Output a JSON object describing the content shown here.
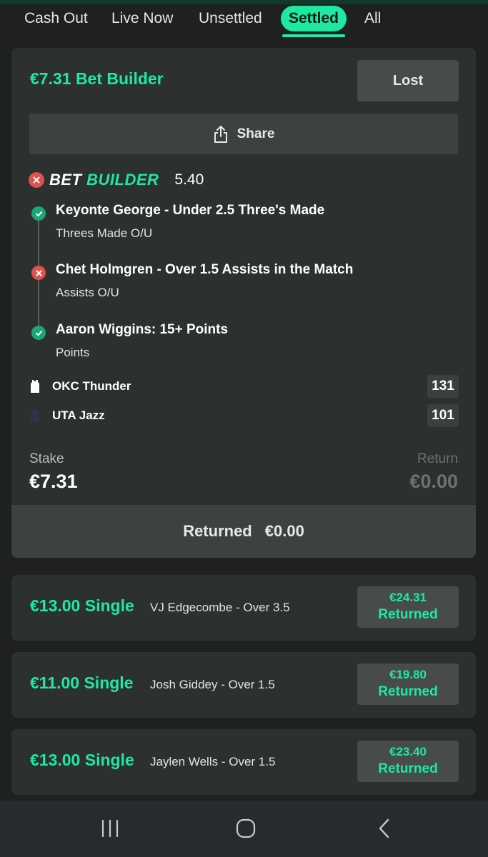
{
  "tabs": [
    {
      "label": "Cash Out",
      "active": false
    },
    {
      "label": "Live Now",
      "active": false
    },
    {
      "label": "Unsettled",
      "active": false
    },
    {
      "label": "Settled",
      "active": true
    },
    {
      "label": "All",
      "active": false
    }
  ],
  "main_bet": {
    "title": "€7.31 Bet Builder",
    "status": "Lost",
    "share_label": "Share",
    "builder_logo_bet": "BET",
    "builder_logo_builder": "BUILDER",
    "builder_result": "lost",
    "odds": "5.40",
    "legs": [
      {
        "title": "Keyonte George - Under 2.5 Three's Made",
        "market": "Threes Made O/U",
        "result": "won"
      },
      {
        "title": "Chet Holmgren - Over 1.5 Assists in the Match",
        "market": "Assists O/U",
        "result": "lost"
      },
      {
        "title": "Aaron Wiggins: 15+ Points",
        "market": "Points",
        "result": "won"
      }
    ],
    "teams": [
      {
        "name": "OKC Thunder",
        "score": "131",
        "jersey_color": "#ffffff"
      },
      {
        "name": "UTA Jazz",
        "score": "101",
        "jersey_color": "#3a2f48"
      }
    ],
    "stake_label": "Stake",
    "stake_value": "€7.31",
    "return_label": "Return",
    "return_value": "€0.00",
    "returned_label": "Returned",
    "returned_value": "€0.00"
  },
  "singles": [
    {
      "title": "€13.00 Single",
      "description": "VJ Edgecombe - Over 3.5",
      "amount": "€24.31",
      "status": "Returned"
    },
    {
      "title": "€11.00 Single",
      "description": "Josh Giddey - Over 1.5",
      "amount": "€19.80",
      "status": "Returned"
    },
    {
      "title": "€13.00 Single",
      "description": "Jaylen Wells - Over 1.5",
      "amount": "€23.40",
      "status": "Returned"
    }
  ],
  "nav": {
    "icons": [
      "recent-apps-icon",
      "home-icon",
      "back-icon"
    ]
  },
  "colors": {
    "accent": "#1de9a3",
    "background": "#1e211f",
    "card": "#2c302e",
    "lost": "#e0504f",
    "won": "#1aa678"
  }
}
